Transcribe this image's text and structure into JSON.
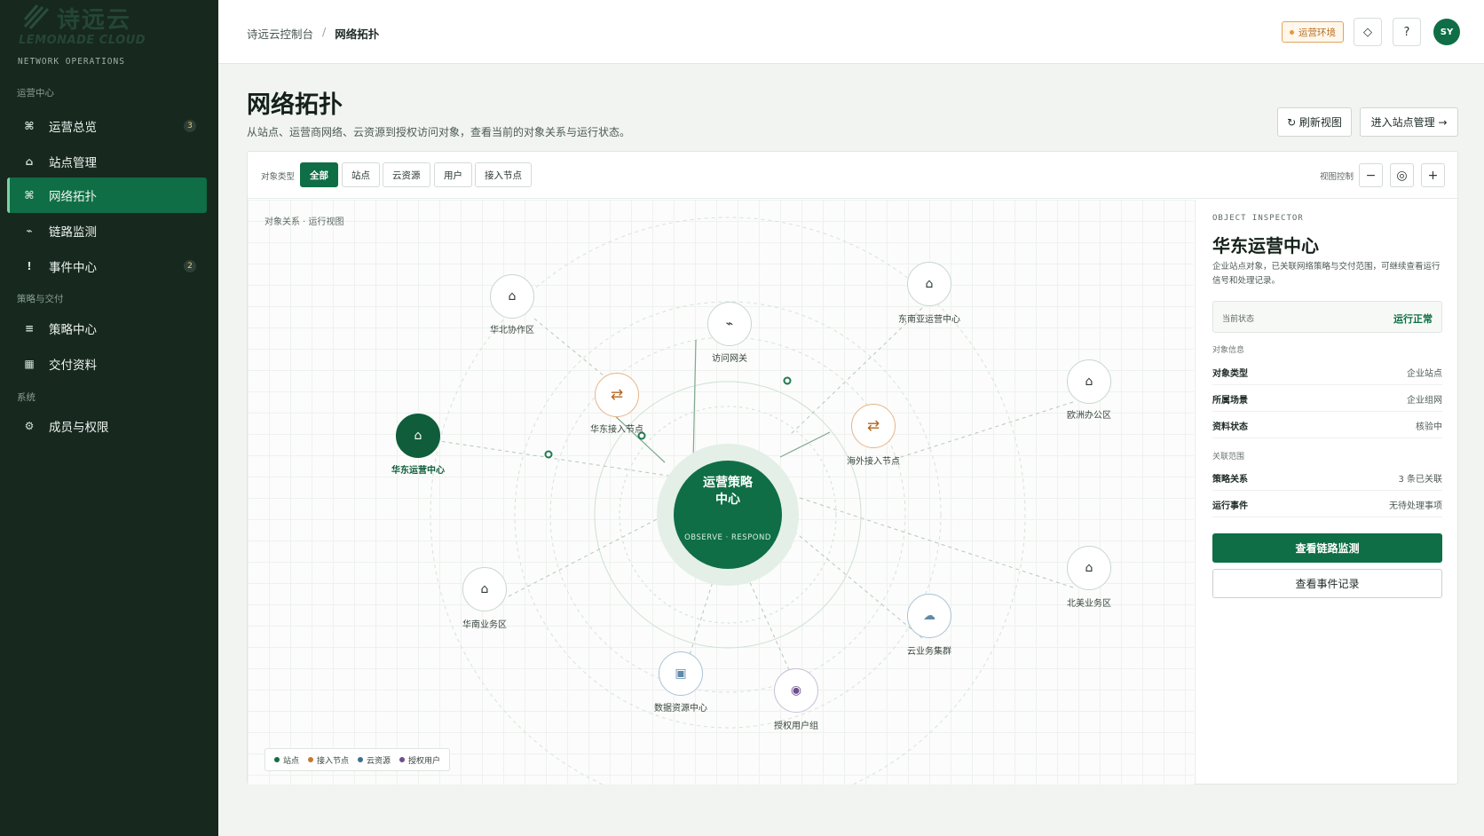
{
  "brand": {
    "name_cn": "诗远云",
    "name_en": "LEMONADE CLOUD",
    "subtitle": "NETWORK OPERATIONS"
  },
  "sidebar": {
    "groups": [
      {
        "label": "运营中心",
        "items": [
          {
            "label": "运营总览",
            "icon": "command-icon",
            "glyph": "⌘",
            "badge": "3"
          },
          {
            "label": "站点管理",
            "icon": "home-icon",
            "glyph": "⌂",
            "badge": ""
          },
          {
            "label": "网络拓扑",
            "icon": "topology-icon",
            "glyph": "⌘",
            "badge": "",
            "active": true
          },
          {
            "label": "链路监测",
            "icon": "pulse-icon",
            "glyph": "⌁",
            "badge": ""
          },
          {
            "label": "事件中心",
            "icon": "alert-icon",
            "glyph": "!",
            "badge": "2"
          }
        ]
      },
      {
        "label": "策略与交付",
        "items": [
          {
            "label": "策略中心",
            "icon": "list-icon",
            "glyph": "≡",
            "badge": ""
          },
          {
            "label": "交付资料",
            "icon": "document-icon",
            "glyph": "▦",
            "badge": ""
          }
        ]
      },
      {
        "label": "系统",
        "items": [
          {
            "label": "成员与权限",
            "icon": "gear-icon",
            "glyph": "⚙",
            "badge": ""
          }
        ]
      }
    ]
  },
  "topbar": {
    "breadcrumb": [
      "诗远云控制台",
      "网络拓扑"
    ],
    "separator": "/",
    "env_badge": "运营环境",
    "buttons": [
      {
        "icon": "diamond-icon",
        "glyph": "◇"
      },
      {
        "icon": "help-icon",
        "glyph": "?"
      }
    ],
    "avatar": "SY"
  },
  "page": {
    "title": "网络拓扑",
    "description": "从站点、运营商网络、云资源到授权访问对象，查看当前的对象关系与运行状态。",
    "actions": {
      "refresh": "↻ 刷新视图",
      "site_management": "进入站点管理 →"
    }
  },
  "filters": {
    "label": "对象类型",
    "chips": [
      "全部",
      "站点",
      "云资源",
      "用户",
      "接入节点"
    ],
    "active": "全部",
    "view_label": "视图控制",
    "controls": [
      {
        "icon": "zoom-out-icon",
        "glyph": "−"
      },
      {
        "icon": "target-icon",
        "glyph": "◎"
      },
      {
        "icon": "zoom-in-icon",
        "glyph": "+"
      }
    ]
  },
  "topology": {
    "caption": "对象关系 · 运行视图",
    "hub": {
      "title": "运营策略中心",
      "subtitle": "OBSERVE · RESPOND"
    },
    "nodes": [
      {
        "id": "huabei",
        "label": "华北协作区",
        "type": "site",
        "glyph": "⌂"
      },
      {
        "id": "gateway",
        "label": "访问网关",
        "type": "site",
        "glyph": "⌁"
      },
      {
        "id": "sea",
        "label": "东南亚运营中心",
        "type": "site",
        "glyph": "⌂"
      },
      {
        "id": "europe",
        "label": "欧洲办公区",
        "type": "site",
        "glyph": "⌂"
      },
      {
        "id": "huadong_access",
        "label": "华东接入节点",
        "type": "access",
        "glyph": "⇄"
      },
      {
        "id": "overseas_access",
        "label": "海外接入节点",
        "type": "access",
        "glyph": "⇄"
      },
      {
        "id": "huadong",
        "label": "华东运营中心",
        "type": "site-active",
        "glyph": "⌂"
      },
      {
        "id": "huanan",
        "label": "华南业务区",
        "type": "site",
        "glyph": "⌂"
      },
      {
        "id": "northamerica",
        "label": "北美业务区",
        "type": "site",
        "glyph": "⌂"
      },
      {
        "id": "cloud_cluster",
        "label": "云业务集群",
        "type": "cloud",
        "glyph": "☁"
      },
      {
        "id": "data_center",
        "label": "数据资源中心",
        "type": "cloud",
        "glyph": "▣"
      },
      {
        "id": "user_group",
        "label": "授权用户组",
        "type": "user",
        "glyph": "◉"
      }
    ],
    "legend": [
      {
        "label": "站点",
        "color": "#0f6e45"
      },
      {
        "label": "接入节点",
        "color": "#c47a2c"
      },
      {
        "label": "云资源",
        "color": "#3f6f8f"
      },
      {
        "label": "授权用户",
        "color": "#6d4f8e"
      }
    ]
  },
  "inspector": {
    "kicker": "OBJECT INSPECTOR",
    "title": "华东运营中心",
    "description": "企业站点对象，已关联网络策略与交付范围，可继续查看运行信号和处理记录。",
    "status_label": "当前状态",
    "status_value": "运行正常",
    "info_section": "对象信息",
    "info": [
      {
        "key": "对象类型",
        "value": "企业站点"
      },
      {
        "key": "所属场景",
        "value": "企业组网"
      },
      {
        "key": "资料状态",
        "value": "核验中"
      }
    ],
    "scope_section": "关联范围",
    "scope": [
      {
        "key": "策略关系",
        "value": "3 条已关联"
      },
      {
        "key": "运行事件",
        "value": "无待处理事项"
      }
    ],
    "primary_action": "查看链路监测",
    "secondary_action": "查看事件记录"
  },
  "colors": {
    "brand": "#0f6e45",
    "sidebar": "#17281f",
    "accent_orange": "#c47a2c"
  }
}
